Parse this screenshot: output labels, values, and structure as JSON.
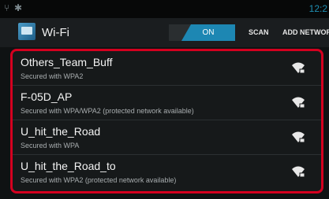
{
  "status_bar": {
    "left_icons": [
      "usb-icon",
      "android-debug-icon"
    ],
    "clock": "12:2"
  },
  "action_bar": {
    "title": "Wi-Fi",
    "toggle_label": "ON",
    "scan_label": "SCAN",
    "add_network_label": "ADD NETWORK"
  },
  "colors": {
    "accent": "#1d87b3",
    "highlight_frame": "#d4001f"
  },
  "networks": [
    {
      "ssid": "Others_Team_Buff",
      "security": "Secured with WPA2",
      "signal_icon": "wifi-locked-icon"
    },
    {
      "ssid": "F-05D_AP",
      "security": "Secured with WPA/WPA2 (protected network available)",
      "signal_icon": "wifi-locked-icon"
    },
    {
      "ssid": "U_hit_the_Road",
      "security": "Secured with WPA",
      "signal_icon": "wifi-locked-icon"
    },
    {
      "ssid": "U_hit_the_Road_to",
      "security": "Secured with WPA2 (protected network available)",
      "signal_icon": "wifi-locked-icon"
    }
  ]
}
